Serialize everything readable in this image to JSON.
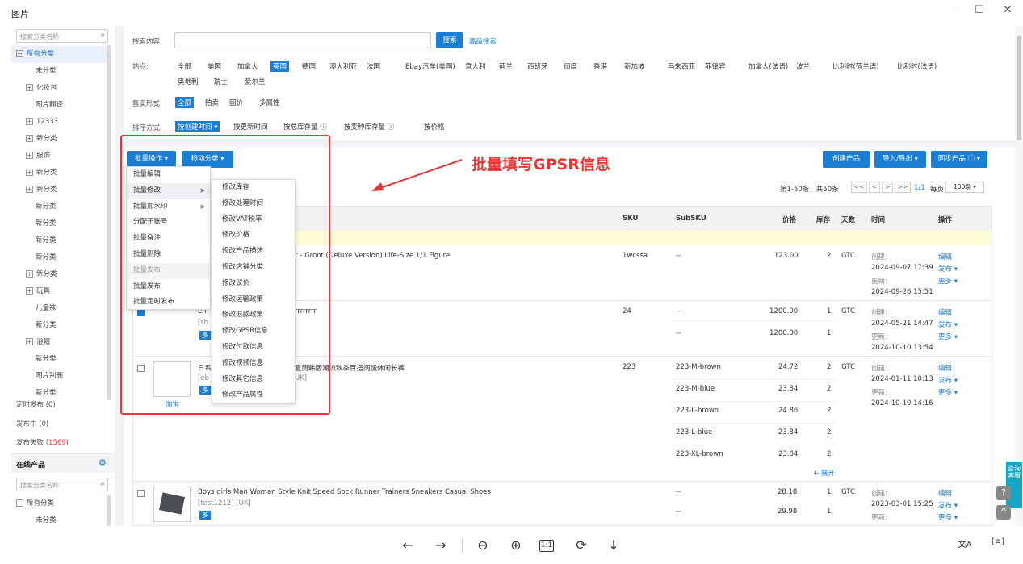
{
  "window": {
    "title": "图片",
    "minimize": "—",
    "maximize": "☐",
    "close": "✕"
  },
  "sidebar": {
    "search_placeholder": "搜索分类名称",
    "tree": [
      {
        "label": "所有分类",
        "box": "−",
        "indent": 0,
        "selected": true
      },
      {
        "label": "未分类",
        "indent": 2
      },
      {
        "label": "化妆包",
        "box": "+",
        "indent": 1
      },
      {
        "label": "图片翻译",
        "indent": 2
      },
      {
        "label": "12333",
        "box": "+",
        "indent": 1
      },
      {
        "label": "新分类",
        "box": "+",
        "indent": 1
      },
      {
        "label": "服饰",
        "box": "+",
        "indent": 1
      },
      {
        "label": "新分类",
        "box": "+",
        "indent": 1
      },
      {
        "label": "新分类",
        "box": "+",
        "indent": 1
      },
      {
        "label": "新分类",
        "indent": 2
      },
      {
        "label": "新分类",
        "indent": 2
      },
      {
        "label": "新分类",
        "indent": 2
      },
      {
        "label": "新分类",
        "indent": 2
      },
      {
        "label": "新分类",
        "box": "+",
        "indent": 1
      },
      {
        "label": "玩具",
        "box": "+",
        "indent": 1
      },
      {
        "label": "儿童袜",
        "indent": 2
      },
      {
        "label": "新分类",
        "indent": 2
      },
      {
        "label": "浴帽",
        "box": "+",
        "indent": 1
      },
      {
        "label": "新分类",
        "indent": 2
      },
      {
        "label": "图片别删",
        "indent": 2
      },
      {
        "label": "新分类",
        "indent": 2
      }
    ],
    "scheduled": "定时发布 (0)",
    "publishing": "发布中 (0)",
    "failed_label": "发布失败 (",
    "failed_count": "1569",
    "failed_close": ")",
    "online_header": "在线产品",
    "online_search_placeholder": "搜索分类名称",
    "online_tree": [
      {
        "label": "所有分类",
        "box": "−",
        "indent": 0
      },
      {
        "label": "未分类",
        "indent": 2
      }
    ]
  },
  "filters": {
    "search_label": "搜索内容:",
    "search_value": "",
    "search_button": "搜索",
    "advanced_search": "高级搜索",
    "site_label": "站点:",
    "sites_row1": [
      "全部",
      "美国",
      "加拿大",
      "英国",
      "德国",
      "澳大利亚",
      "法国",
      "Ebay汽车(美国)",
      "意大利",
      "荷兰",
      "西班牙",
      "印度",
      "香港",
      "新加坡",
      "马来西亚",
      "菲律宾",
      "加拿大(法语)",
      "波兰",
      "比利时(荷兰语)",
      "比利时(法语)"
    ],
    "sites_row2": [
      "奥地利",
      "瑞士",
      "爱尔兰"
    ],
    "active_site": "英国",
    "format_label": "售卖形式:",
    "formats": [
      "全部",
      "拍卖",
      "固价",
      "多属性"
    ],
    "active_format": "全部",
    "sort_label": "排序方式:",
    "sort_active": "按创建时间 ▾",
    "sort_options": [
      "按更新时间",
      "按总库存量 ⓘ",
      "按变种库存量 ⓘ",
      "按价格"
    ]
  },
  "actions": {
    "bulk_ops": "批量操作 ▾",
    "move_category": "移动分类 ▾",
    "create_product": "创建产品",
    "import_export": "导入/导出 ▾",
    "sync_products": "同步产品 ⓘ ▾"
  },
  "annotation": "批量填写GPSR信息",
  "pagination": {
    "range": "第1-50条，共50条",
    "first": "<<",
    "prev": "<",
    "next": ">",
    "last": ">>",
    "page": "1/1",
    "per_page_label": "每页",
    "per_page": "100条 ▾"
  },
  "table": {
    "headers": {
      "sku": "SKU",
      "subsku": "SubSKU",
      "price": "价格",
      "stock": "库存",
      "days": "天数",
      "time": "时间",
      "ops": "操作"
    },
    "ops_edit": "编辑",
    "ops_publish": "发布 ▾",
    "ops_more": "更多 ▾",
    "created_label": "创建:",
    "updated_label": "更新:",
    "rows": [
      {
        "title_fragment": "oot - Groot (Deluxe Version) Life-Size 1/1 Figure",
        "sku": "1wcssa",
        "variants": [
          {
            "subsku": "--",
            "price": "123.00",
            "stock": "2"
          }
        ],
        "days": "GTC",
        "created": "2024-09-07 17:39",
        "updated": "2024-09-26 15:51"
      },
      {
        "title_prefix": "eff",
        "title_fragment": "rrrrrrrr",
        "store_prefix": "[sh",
        "badge": "多",
        "sku": "24",
        "variants": [
          {
            "subsku": "--",
            "price": "1200.00",
            "stock": "1"
          },
          {
            "subsku": "--",
            "price": "1200.00",
            "stock": "1"
          }
        ],
        "days": "GTC",
        "created": "2024-05-21 14:47",
        "updated": "2024-10-10 13:54"
      },
      {
        "title_prefix": "日系",
        "title_fragment": "直筒韩版潮流秋季百搭阔腿休闲长裤",
        "store_prefix": "[eb",
        "store_suffix": "UK]",
        "badge": "多",
        "image_caption": "淘宝",
        "sku": "223",
        "variants": [
          {
            "subsku": "223-M-brown",
            "price": "24.72",
            "stock": "2"
          },
          {
            "subsku": "223-M-blue",
            "price": "23.84",
            "stock": "2"
          },
          {
            "subsku": "223-L-brown",
            "price": "24.86",
            "stock": "2"
          },
          {
            "subsku": "223-L-blue",
            "price": "23.84",
            "stock": "2"
          },
          {
            "subsku": "223-XL-brown",
            "price": "23.84",
            "stock": "2"
          }
        ],
        "expand": "+ 展开",
        "days": "GTC",
        "created": "2024-01-11 10:13",
        "updated": "2024-10-10 14:16"
      },
      {
        "title": "Boys girls Man Woman Style Knit Speed Sock Runner Trainers Sneakers Casual Shoes",
        "store": "[test1212] [UK]",
        "badge": "多",
        "sku": "",
        "variants": [
          {
            "subsku": "--",
            "price": "28.18",
            "stock": "1"
          },
          {
            "subsku": "--",
            "price": "29.98",
            "stock": "1"
          }
        ],
        "days": "GTC",
        "created": "2023-03-01 15:25",
        "updated": ""
      }
    ]
  },
  "bulk_menu": [
    "批量编辑",
    "批量修改",
    "批量加水印",
    "分配子账号",
    "批量备注",
    "批量删除",
    "批量发布",
    "批量发布",
    "批量定时发布"
  ],
  "bulk_submenu": [
    "修改库存",
    "修改处理时间",
    "修改VAT税率",
    "修改价格",
    "修改产品描述",
    "修改店铺分类",
    "修改议价",
    "修改运输政策",
    "修改退款政策",
    "修改GPSR信息",
    "修改付款信息",
    "修改视频信息",
    "修改其它信息",
    "修改产品属性"
  ],
  "widget": {
    "consult": "咨询客服",
    "help": "?",
    "top": "^"
  },
  "viewer_toolbar": [
    "←",
    "→",
    "⊖",
    "⊕",
    "1:1",
    "⟳",
    "↓"
  ],
  "viewer_right": [
    "文A",
    "[≡]"
  ],
  "colors": {
    "accent": "#1a7fd4",
    "annotation": "#e23a3a",
    "danger": "#e33",
    "widget": "#16a6c4"
  }
}
